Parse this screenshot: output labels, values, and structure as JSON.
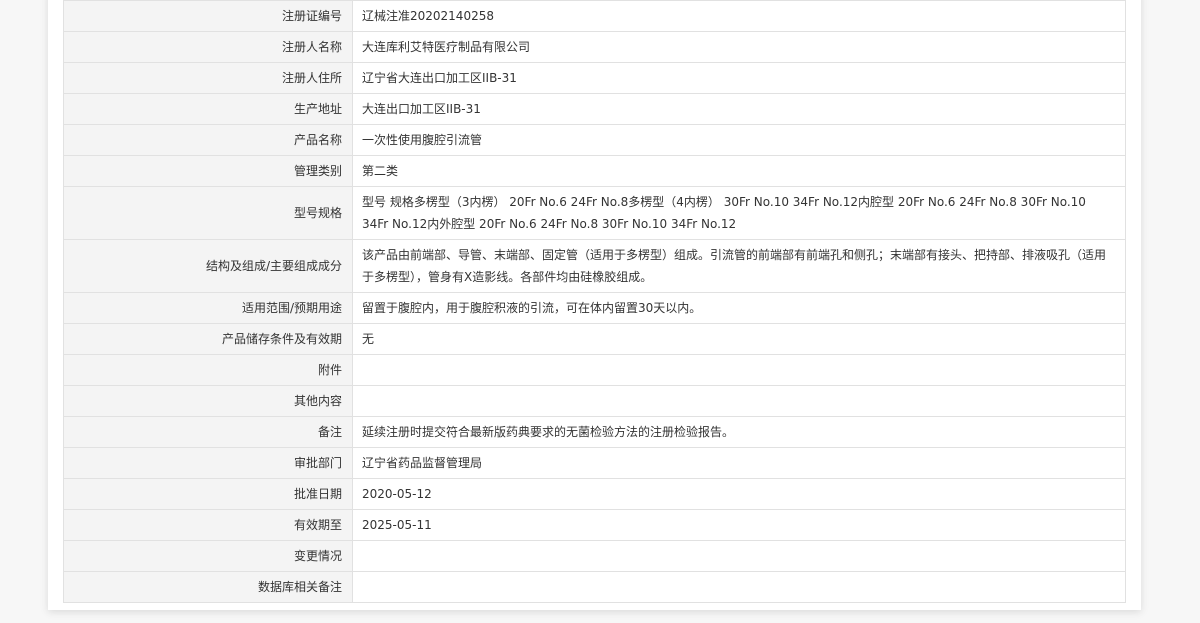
{
  "rows": [
    {
      "label": "注册证编号",
      "value": "辽械注准20202140258"
    },
    {
      "label": "注册人名称",
      "value": "大连库利艾特医疗制品有限公司"
    },
    {
      "label": "注册人住所",
      "value": "辽宁省大连出口加工区IIB-31"
    },
    {
      "label": "生产地址",
      "value": "大连出口加工区IIB-31"
    },
    {
      "label": "产品名称",
      "value": "一次性使用腹腔引流管"
    },
    {
      "label": "管理类别",
      "value": "第二类"
    },
    {
      "label": "型号规格",
      "value": "型号 规格多楞型（3内楞） 20Fr No.6 24Fr No.8多楞型（4内楞） 30Fr No.10 34Fr No.12内腔型 20Fr No.6 24Fr No.8 30Fr No.10 34Fr No.12内外腔型 20Fr No.6 24Fr No.8 30Fr No.10 34Fr No.12"
    },
    {
      "label": "结构及组成/主要组成成分",
      "value": "该产品由前端部、导管、末端部、固定管（适用于多楞型）组成。引流管的前端部有前端孔和侧孔；末端部有接头、把持部、排液吸孔（适用于多楞型），管身有X造影线。各部件均由硅橡胶组成。"
    },
    {
      "label": "适用范围/预期用途",
      "value": "留置于腹腔内，用于腹腔积液的引流，可在体内留置30天以内。"
    },
    {
      "label": "产品储存条件及有效期",
      "value": "无"
    },
    {
      "label": "附件",
      "value": ""
    },
    {
      "label": "其他内容",
      "value": ""
    },
    {
      "label": "备注",
      "value": "延续注册时提交符合最新版药典要求的无菌检验方法的注册检验报告。"
    },
    {
      "label": "审批部门",
      "value": "辽宁省药品监督管理局"
    },
    {
      "label": "批准日期",
      "value": "2020-05-12"
    },
    {
      "label": "有效期至",
      "value": "2025-05-11"
    },
    {
      "label": "变更情况",
      "value": ""
    },
    {
      "label": "数据库相关备注",
      "value": ""
    }
  ]
}
